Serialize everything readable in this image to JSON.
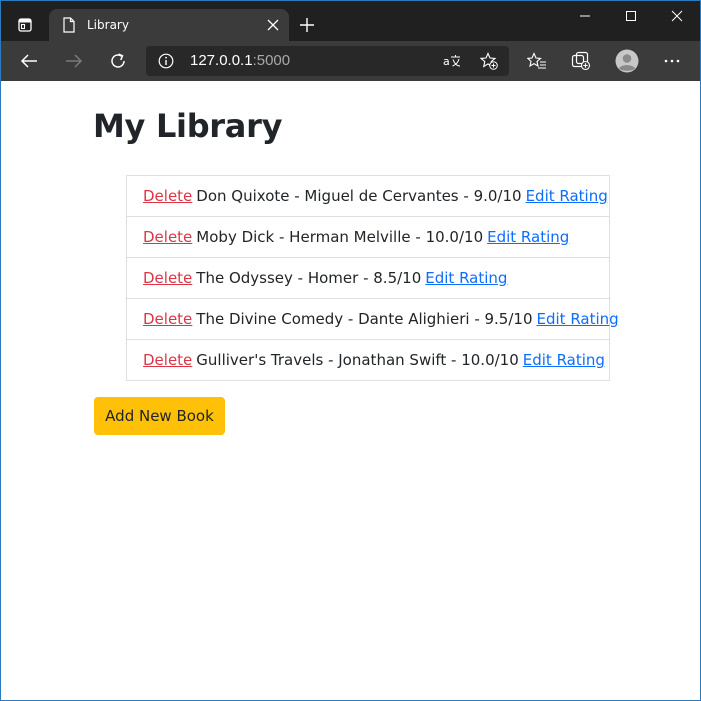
{
  "browser": {
    "tab_title": "Library",
    "url_host": "127.0.0.1",
    "url_port": ":5000",
    "icons": {
      "tab_actions": "tab-actions-icon",
      "page": "page-icon",
      "close_tab": "close-icon",
      "new_tab": "plus-icon",
      "minimize": "minimize-icon",
      "maximize": "maximize-icon",
      "close_window": "close-icon",
      "back": "back-arrow-icon",
      "forward": "forward-arrow-icon",
      "refresh": "refresh-icon",
      "info": "info-icon",
      "read_aloud": "read-aloud-icon",
      "add_favorite": "add-favorite-icon",
      "favorites": "favorites-icon",
      "collections": "collections-icon",
      "profile": "profile-avatar",
      "more": "more-icon"
    }
  },
  "page": {
    "title": "My Library",
    "books": [
      {
        "delete_label": "Delete",
        "text": "Don Quixote - Miguel de Cervantes - 9.0/10",
        "edit_label": "Edit Rating"
      },
      {
        "delete_label": "Delete",
        "text": "Moby Dick - Herman Melville - 10.0/10",
        "edit_label": "Edit Rating"
      },
      {
        "delete_label": "Delete",
        "text": "The Odyssey - Homer - 8.5/10",
        "edit_label": "Edit Rating"
      },
      {
        "delete_label": "Delete",
        "text": "The Divine Comedy - Dante Alighieri - 9.5/10",
        "edit_label": "Edit Rating"
      },
      {
        "delete_label": "Delete",
        "text": "Gulliver's Travels - Jonathan Swift - 10.0/10",
        "edit_label": "Edit Rating"
      }
    ],
    "add_button_label": "Add New Book"
  },
  "colors": {
    "delete": "#dc3545",
    "edit": "#0d6efd",
    "add_button": "#ffc107",
    "titlebar": "#202020",
    "toolbar": "#3b3b3b"
  }
}
